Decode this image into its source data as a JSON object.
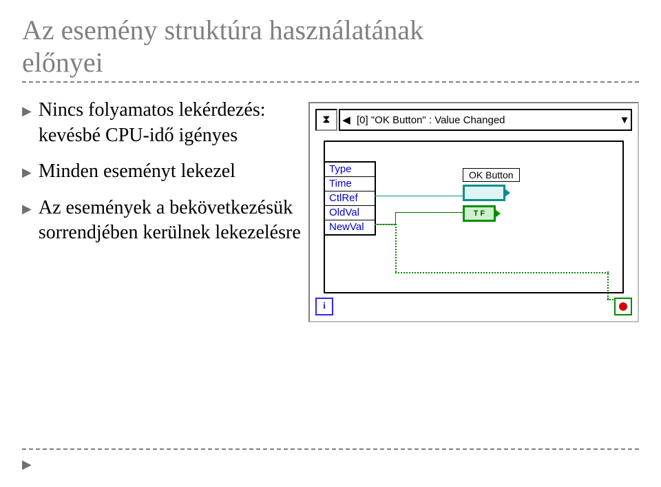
{
  "title_line1": "Az esemény struktúra használatának",
  "title_line2": "előnyei",
  "bullets": [
    "Nincs folyamatos lekérdezés: kevésbé CPU-idő igényes",
    "Minden eseményt lekezel",
    "Az események a bekövetkezésük sorrendjében kerülnek lekezelésre"
  ],
  "diagram": {
    "case_prev": "◀",
    "case_next": "▼",
    "case_label": "[0] \"OK Button\" : Value Changed",
    "event_fields": [
      "Type",
      "Time",
      "CtlRef",
      "OldVal",
      "NewVal"
    ],
    "string_indicator_label": "OK Button",
    "boolean_indicator_text": "T F",
    "loop_index": "i"
  }
}
